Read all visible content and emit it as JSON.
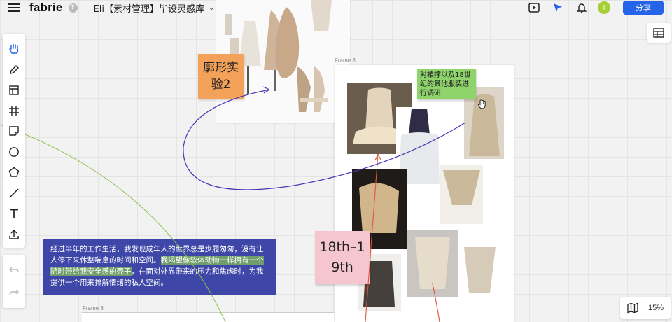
{
  "topbar": {
    "logo": "fabrie",
    "help_glyph": "?",
    "doc_title": "Eli【素材管理】毕设灵感库",
    "chevron": "⌄",
    "avatar_initial": "I",
    "share_label": "分享",
    "icons": [
      "menu-icon",
      "present-icon",
      "cursor-icon",
      "bell-icon"
    ]
  },
  "toolbar": {
    "tools": [
      "hand-icon",
      "pen-icon",
      "layout-icon",
      "frame-icon",
      "sticky-note-icon",
      "circle-icon",
      "pentagon-icon",
      "line-icon",
      "text-icon",
      "upload-icon"
    ],
    "history": [
      "undo-icon",
      "redo-icon"
    ]
  },
  "zoom": {
    "value": "15%",
    "icon": "map-icon"
  },
  "right_panel": {
    "icon": "table-icon"
  },
  "frames": [
    {
      "label": "Frame 8"
    },
    {
      "label": "Frame 3"
    }
  ],
  "notes": {
    "orange": {
      "line1": "廓形实",
      "line2": "验2"
    },
    "green": {
      "text": "对裙撑以及18世纪的其他服装进行调研"
    },
    "pink": {
      "line1": "18th–1",
      "line2": "9th"
    },
    "blue": {
      "part1": "经过半年的工作生活，我发现成年人的世界总是步履匆匆，没有让人停下来休整喘息的时间和空间。",
      "highlight": "我渴望像软体动物一样拥有一个随时带给我安全感的壳子",
      "part2": "，在面对外界带来的压力和焦虑时，为我提供一个用来排解情绪的私人空间。"
    }
  },
  "colors": {
    "accent": "#2563e8",
    "orange_note": "#f4a25a",
    "green_note": "#8fd36d",
    "pink_note": "#f5c6cf",
    "blue_note": "#3e47a8",
    "purple_connector": "#4b33b5",
    "orange_connector": "#e0553a",
    "green_connector": "#8bc34a"
  }
}
